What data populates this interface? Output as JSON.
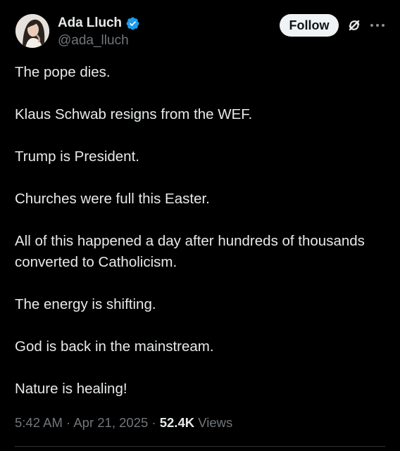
{
  "author": {
    "display_name": "Ada Lluch",
    "handle": "@ada_lluch",
    "verified": true,
    "verified_color": "#1d9bf0"
  },
  "actions": {
    "follow_label": "Follow",
    "grok_icon": "grok-icon",
    "more_icon": "more-dots-icon"
  },
  "post": {
    "paragraphs": [
      "The pope dies.",
      "Klaus Schwab resigns from the WEF.",
      "Trump is President.",
      "Churches were full this Easter.",
      "All of this happened a day after hundreds of thousands converted to Catholicism.",
      "The energy is shifting.",
      "God is back in the mainstream.",
      "Nature is healing!"
    ]
  },
  "meta": {
    "time": "5:42 AM",
    "separator": "·",
    "date": "Apr 21, 2025",
    "views_count": "52.4K",
    "views_label": "Views"
  },
  "colors": {
    "background": "#000000",
    "text_primary": "#e7e9ea",
    "text_secondary": "#71767b",
    "follow_bg": "#eff3f4",
    "follow_text": "#0f1419",
    "divider": "#2f3336"
  }
}
